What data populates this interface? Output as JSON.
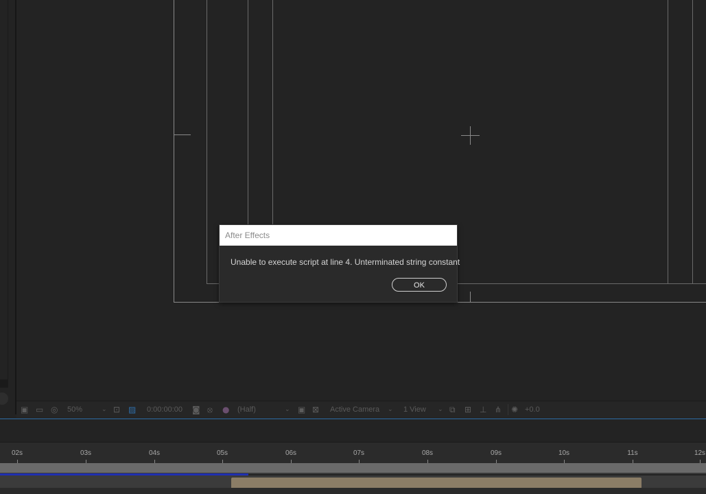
{
  "viewer_toolbar": {
    "magnification": "50%",
    "timecode": "0:00:00:00",
    "resolution": "(Half)",
    "camera": "Active Camera",
    "views": "1 View",
    "exposure": "+0.0",
    "icons": [
      "always-preview-icon",
      "monitor-icon",
      "mask-visibility-icon",
      "region-of-interest-icon",
      "transparency-grid-icon",
      "snapshot-icon",
      "show-snapshot-icon",
      "color-channel-icon",
      "fast-preview-icon",
      "toggle-mask-icon",
      "3d-view-icon",
      "flowchart-icon",
      "reset-exposure-icon"
    ]
  },
  "timeline": {
    "ruler_ticks": [
      "02s",
      "03s",
      "04s",
      "05s",
      "06s",
      "07s",
      "08s",
      "09s",
      "10s",
      "11s",
      "12s"
    ]
  },
  "dialog": {
    "title": "After Effects",
    "message": "Unable to execute script at line 4. Unterminated string constant",
    "ok_label": "OK"
  },
  "colors": {
    "panel_bg": "#232323",
    "timeline_accent": "#2f6ea8",
    "work_area": "#1f2fb0",
    "layer_bar": "#8b7d66"
  }
}
